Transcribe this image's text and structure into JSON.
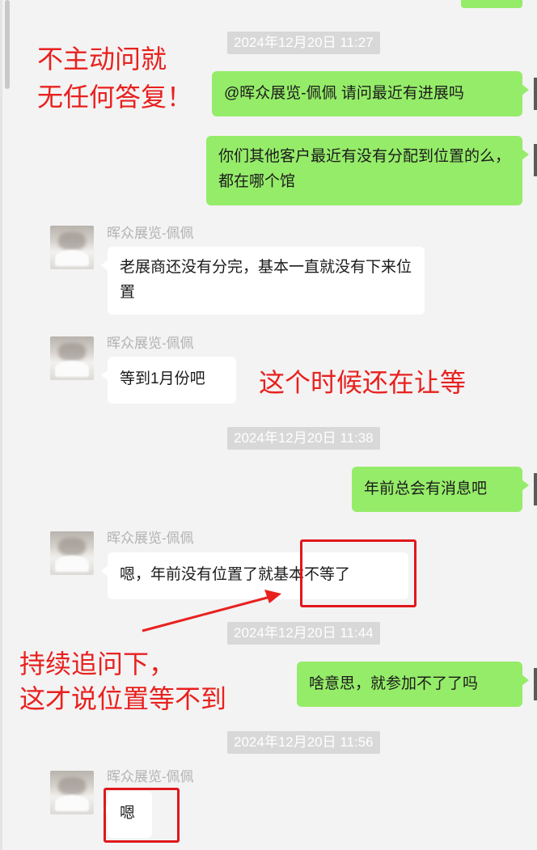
{
  "timestamps": [
    "2024年12月20日 11:27",
    "2024年12月20日 11:38",
    "2024年12月20日 11:44",
    "2024年12月20日 11:56"
  ],
  "contact_name": "晖众展览-佩佩",
  "messages": [
    {
      "dir": "out",
      "text": "@晖众展览-佩佩 请问最近有进展吗"
    },
    {
      "dir": "out",
      "text": "你们其他客户最近有没有分配到位置的么，都在哪个馆"
    },
    {
      "dir": "in",
      "text": "老展商还没有分完，基本一直就没有下来位置"
    },
    {
      "dir": "in",
      "text": "等到1月份吧"
    },
    {
      "dir": "out",
      "text": "年前总会有消息吧"
    },
    {
      "dir": "in",
      "text": "嗯，年前没有位置了就基本不等了"
    },
    {
      "dir": "out",
      "text": "啥意思，就参加不了了吗"
    },
    {
      "dir": "in",
      "text": "嗯"
    }
  ],
  "annotations": {
    "a1_line1": "不主动问就",
    "a1_line2": "无任何答复！",
    "a2": "这个时候还在让等",
    "a3_line1": "持续追问下，",
    "a3_line2": "这才说位置等不到"
  },
  "colors": {
    "bubble_out": "#95ec69",
    "bubble_in": "#ffffff",
    "annotation_red": "#e8211f",
    "background": "#f3f3f3"
  }
}
